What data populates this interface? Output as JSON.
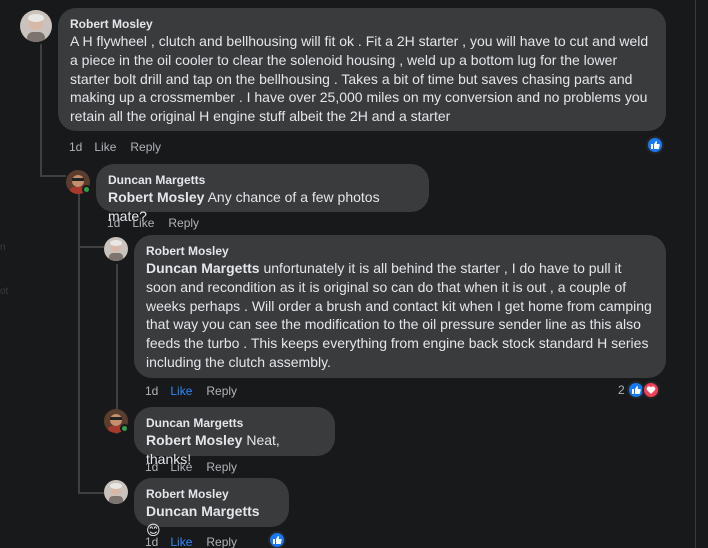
{
  "colors": {
    "background": "#18191a",
    "bubble": "#3a3b3c",
    "text": "#e4e6eb",
    "secondary": "#b0b3b8",
    "link_blue": "#2d88ff",
    "like_blue": "#1877f2",
    "love_red": "#f33e58",
    "online": "#31a24c"
  },
  "comments": [
    {
      "author": "Robert Mosley",
      "mention": "",
      "text": "A H flywheel , clutch and bellhousing will fit ok . Fit a 2H starter , you will have to cut and weld a piece in the oil cooler to clear the solenoid housing , weld up a bottom lug for the lower starter bolt drill and tap on the bellhousing . Takes a bit of time but saves chasing parts and making up a crossmember . I have over 25,000 miles on my conversion and no problems you retain all the original H engine stuff albeit the 2H and a starter",
      "time": "1d",
      "like": "Like",
      "reply": "Reply",
      "reaction_icons": [
        "like-icon"
      ],
      "reaction_count": ""
    },
    {
      "author": "Duncan Margetts",
      "mention": "Robert Mosley",
      "text": " Any chance of a few photos mate?",
      "time": "1d",
      "like": "Like",
      "reply": "Reply",
      "reaction_icons": [],
      "reaction_count": ""
    },
    {
      "author": "Robert Mosley",
      "mention": "Duncan Margetts",
      "text": " unfortunately it is all behind the starter , I do have to pull it soon and recondition as it is original so can do that when it is out , a couple of weeks perhaps . Will order a brush and contact kit when I get home from camping that way you can see the modification to the oil pressure sender line as this also feeds the turbo . This keeps everything from engine back stock standard H series including the clutch assembly.",
      "time": "1d",
      "like": "Like",
      "reply": "Reply",
      "liked": true,
      "reaction_icons": [
        "like-icon",
        "love-icon"
      ],
      "reaction_count": "2"
    },
    {
      "author": "Duncan Margetts",
      "mention": "Robert Mosley",
      "text": " Neat, thanks!",
      "time": "1d",
      "like": "Like",
      "reply": "Reply",
      "reaction_icons": [],
      "reaction_count": ""
    },
    {
      "author": "Robert Mosley",
      "mention": "Duncan Margetts",
      "text": " 😊",
      "time": "1d",
      "like": "Like",
      "reply": "Reply",
      "liked": true,
      "reaction_icons": [
        "like-icon"
      ],
      "reaction_count": ""
    }
  ]
}
